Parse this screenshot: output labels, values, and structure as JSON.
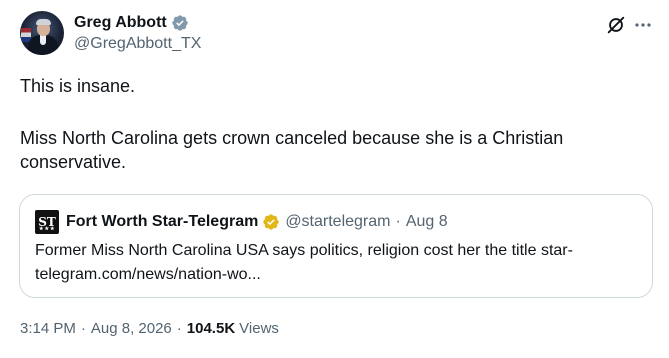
{
  "author": {
    "display_name": "Greg Abbott",
    "handle": "@GregAbbott_TX",
    "verified_badge": "gray-verified-icon",
    "badge_color": "#829aab"
  },
  "tweet": {
    "line1": "This is insane.",
    "line2": "Miss North Carolina gets crown canceled because she is a Christian conservative."
  },
  "quote": {
    "logo_text": "ST",
    "logo_dots": "★★★",
    "name": "Fort Worth Star-Telegram",
    "verified_badge": "gold-verified-icon",
    "badge_color": "#e2b719",
    "handle": "@startelegram",
    "separator": "·",
    "date": "Aug 8",
    "body": "Former Miss North Carolina USA says politics, religion cost her the title star-telegram.com/news/nation-wo..."
  },
  "meta": {
    "time": "3:14 PM",
    "separator": "·",
    "date": "Aug 8, 2026",
    "separator2": "·",
    "views_count": "104.5K",
    "views_label": "Views"
  },
  "icons": {
    "grok": "grok-icon",
    "more": "more-options-icon"
  },
  "colors": {
    "text_primary": "#0f1419",
    "text_secondary": "#536471",
    "border": "#cfd9de"
  }
}
